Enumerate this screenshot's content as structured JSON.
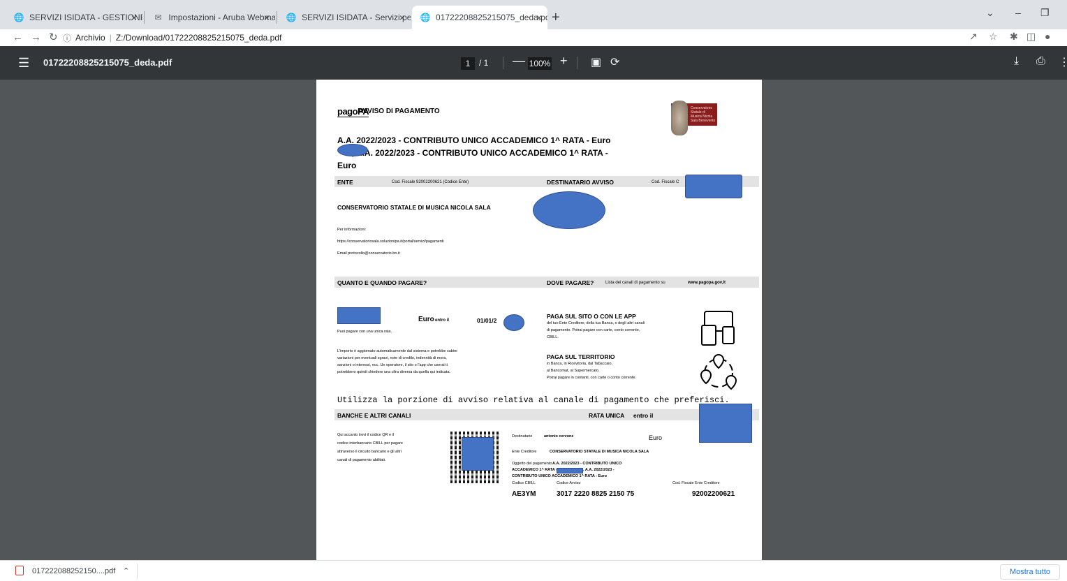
{
  "tabs": [
    {
      "label": "SERVIZI ISIDATA - GESTIONE TIPO",
      "icon": "globe-icon"
    },
    {
      "label": "Impostazioni - Aruba Webmail",
      "icon": "webmail-icon"
    },
    {
      "label": "SERVIZI ISIDATA - Servizi per gli s",
      "icon": "globe-icon"
    },
    {
      "label": "01722208825215075_deda.pdf",
      "icon": "globe-icon"
    }
  ],
  "address": {
    "scheme_label": "Archivio",
    "url": "Z:/Download/01722208825215075_deda.pdf"
  },
  "pdf_toolbar": {
    "title": "01722208825215075_deda.pdf",
    "page_current": "1",
    "page_total": "/ 1",
    "zoom": "100%"
  },
  "doc": {
    "brand": "pagoPA",
    "heading": "AVVISO DI PAGAMENTO",
    "logo_text": "Conservatorio Statale di Musica Nicola Sala Benevento",
    "subject_line1": "A.A. 2022/2023 - CONTRIBUTO UNICO ACCADEMICO 1^ RATA - Euro",
    "subject_line2": "0, A.A. 2022/2023 - CONTRIBUTO UNICO ACCADEMICO 1^ RATA -",
    "subject_line3": "Euro",
    "ente_label": "ENTE",
    "ente_cf": "Cod. Fiscale 92002200621 (Codice Ente)",
    "dest_label": "DESTINATARIO AVVISO",
    "dest_cf": "Cod. Fiscale C",
    "ente_name": "CONSERVATORIO STATALE DI MUSICA NICOLA SALA",
    "info_label": "Per informazioni:",
    "info_url": "https://conservatoriosala.soluzionipa.it/portal/servizi/pagamenti",
    "info_email": "Email protocollo@conservatorio.bn.it",
    "quanto_label": "QUANTO E QUANDO PAGARE?",
    "dove_label": "DOVE PAGARE?",
    "dove_text": "Lista dei canali di pagamento su",
    "dove_link": "www.pagopa.gov.it",
    "euro": "Euro",
    "entro": "entro il",
    "date_partial": "01/01/2",
    "unica_rata": "Puoi pagare con una unica rata.",
    "importo_note": [
      "L'importo è aggiornato automaticamente dal sistema e potrebbe subire",
      "variazioni per eventuali sgravi, note di credito, indennità di mora,",
      "sanzioni o interessi, ecc. Un operatore, il sito o l'app che userai ti",
      "potrebbero quindi chiedere una cifra diversa da quella qui indicata."
    ],
    "paga_sito_title": "PAGA SUL SITO O CON LE APP",
    "paga_sito_text": [
      "del tuo Ente Creditore, della tua Banca, o degli altri canali",
      "di pagamento. Potrai pagare con carte, conto corrente,",
      "CBILL."
    ],
    "paga_terr_title": "PAGA SUL TERRITORIO",
    "paga_terr_text": [
      "in Banca, in Ricevitoria, dal Tabaccaio,",
      "al Bancomat, al Supermercato.",
      "Potrai pagare in contanti, con carte o conto corrente."
    ],
    "utilizza": "Utilizza la porzione di avviso relativa al canale di pagamento che preferisci.",
    "banche_label": "BANCHE E ALTRI CANALI",
    "rata_label": "RATA UNICA",
    "rata_entro": "entro il",
    "qr_text": [
      "Qui accanto trovi il codice QR e il",
      "codice interbancario CBILL per pagare",
      "attraverso il circuito bancario e gli altri",
      "canali di pagamento abilitati."
    ],
    "destinatario_label": "Destinatario",
    "destinatario_name": "antonio cervone",
    "euro2": "Euro",
    "ente_creditore_label": "Ente Creditore",
    "ente_creditore_name": "CONSERVATORIO STATALE DI MUSICA NICOLA SALA",
    "oggetto_label": "Oggetto del pagamento",
    "oggetto_line1": "A.A. 2022/2023 - CONTRIBUTO UNICO",
    "oggetto_line2a": "ACCADEMICO 1^ RATA - Eu",
    "oggetto_line2b": ", A.A. 2022/2023 -",
    "oggetto_line3": "CONTRIBUTO UNICO ACCADEMICO 1^ RATA - Euro",
    "codice_cbill_label": "Codice CBILL",
    "codice_avviso_label": "Codice Avviso",
    "cf_ente_label": "Cod. Fiscale Ente Creditore",
    "codice_cbill": "AE3YM",
    "codice_avviso": "3017 2220 8825 2150 75",
    "cf_ente": "92002200621"
  },
  "download": {
    "filename": "017222088252150....pdf",
    "show_all": "Mostra tutto"
  }
}
